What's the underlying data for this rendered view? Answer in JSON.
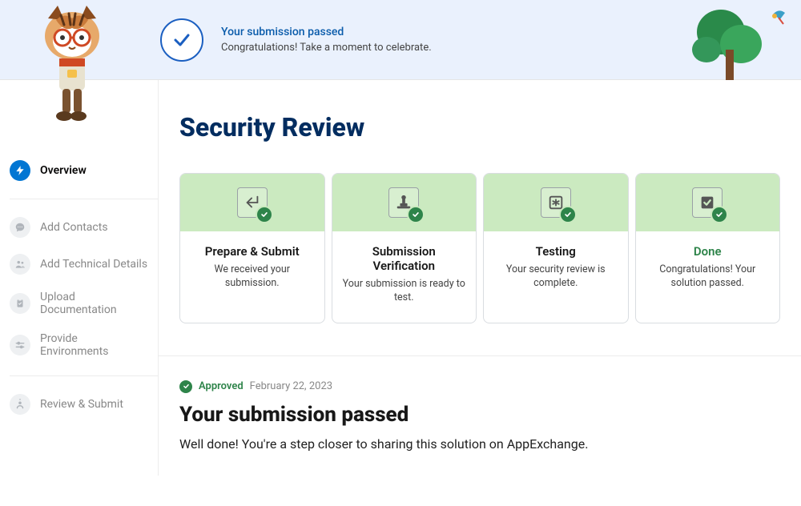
{
  "banner": {
    "title": "Your submission passed",
    "subtitle": "Congratulations! Take a moment to celebrate."
  },
  "sidebar": {
    "items": [
      {
        "label": "Overview"
      },
      {
        "label": "Add Contacts"
      },
      {
        "label": "Add Technical Details"
      },
      {
        "label": "Upload Documentation"
      },
      {
        "label": "Provide Environments"
      },
      {
        "label": "Review & Submit"
      }
    ]
  },
  "page": {
    "title": "Security Review"
  },
  "cards": [
    {
      "title": "Prepare & Submit",
      "desc": "We received your submission."
    },
    {
      "title": "Submission Verification",
      "desc": "Your submission is ready to test."
    },
    {
      "title": "Testing",
      "desc": "Your security review is complete."
    },
    {
      "title": "Done",
      "desc": "Congratulations! Your solution passed."
    }
  ],
  "result": {
    "status_word": "Approved",
    "status_date": "February 22, 2023",
    "title": "Your submission passed",
    "body": "Well done! You're a step closer to sharing this solution on AppExchange."
  }
}
